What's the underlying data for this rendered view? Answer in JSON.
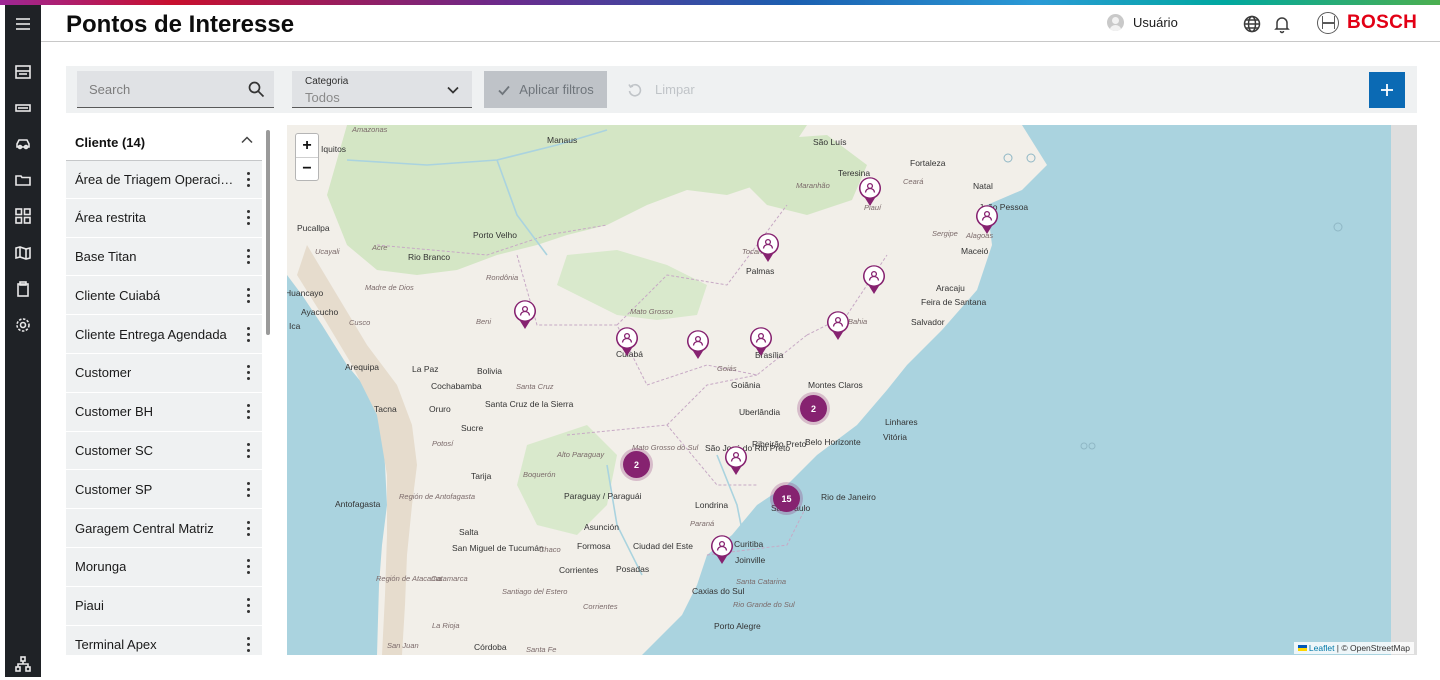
{
  "header": {
    "title": "Pontos de Interesse",
    "user_label": "Usuário",
    "brand": "BOSCH"
  },
  "filters": {
    "search_placeholder": "Search",
    "category_label": "Categoria",
    "category_value": "Todos",
    "apply_label": "Aplicar filtros",
    "clear_label": "Limpar"
  },
  "group": {
    "title": "Cliente (14)"
  },
  "items": [
    "Área de Triagem Operacional",
    "Área restrita",
    "Base Titan",
    "Cliente Cuiabá",
    "Cliente Entrega Agendada",
    "Customer",
    "Customer BH",
    "Customer SC",
    "Customer SP",
    "Garagem Central Matriz",
    "Morunga",
    "Piaui",
    "Terminal Apex"
  ],
  "map": {
    "zoom_in": "+",
    "zoom_out": "−",
    "attribution_leaflet": "Leaflet",
    "attribution_rest": " | © OpenStreetMap",
    "clusters": [
      "2",
      "2",
      "15"
    ],
    "cities": [
      "Manaus",
      "São Luís",
      "Teresina",
      "Fortaleza",
      "Natal",
      "João Pessoa",
      "Maceió",
      "Aracaju",
      "Feira de Santana",
      "Salvador",
      "Palmas",
      "Porto Velho",
      "Rio Branco",
      "Iquitos",
      "Pucallpa",
      "Ayacucho",
      "Huancayo",
      "Ica",
      "Arequipa",
      "La Paz",
      "Cochabamba",
      "Bolivia",
      "Santa Cruz de la Sierra",
      "Sucre",
      "Oruro",
      "Tacna",
      "Cuiabá",
      "Brasília",
      "Goiânia",
      "Montes Claros",
      "Uberlândia",
      "Belo Horizonte",
      "Linhares",
      "Vitória",
      "Ribeirão Preto",
      "São José do Rio Preto",
      "Rio de Janeiro",
      "São Paulo",
      "Londrina",
      "Curitiba",
      "Joinville",
      "Caxias do Sul",
      "Porto Alegre",
      "Asunción",
      "Paraguay / Paraguái",
      "Formosa",
      "Ciudad del Este",
      "Posadas",
      "Corrientes",
      "Salta",
      "San Miguel de Tucumán",
      "Tarija",
      "Antofagasta",
      "Córdoba"
    ],
    "regions": [
      "Amazonas",
      "Maranhão",
      "Ceará",
      "Piauí",
      "Tocantins",
      "Bahia",
      "Goiás",
      "Mato Grosso",
      "Acre",
      "Rondônia",
      "Ucayali",
      "Madre de Dios",
      "Cusco",
      "Beni",
      "Santa Cruz",
      "Potosí",
      "Mato Grosso do Sul",
      "Alto Paraguay",
      "Boquerón",
      "Chaco",
      "Paraná",
      "Santa Catarina",
      "Rio Grande do Sul",
      "Corrientes",
      "Santa Fe",
      "La Rioja",
      "San Juan",
      "Región de Antofagasta",
      "Región de Atacama",
      "Catamarca",
      "Santiago del Estero",
      "Sergipe",
      "Alagoas"
    ]
  }
}
